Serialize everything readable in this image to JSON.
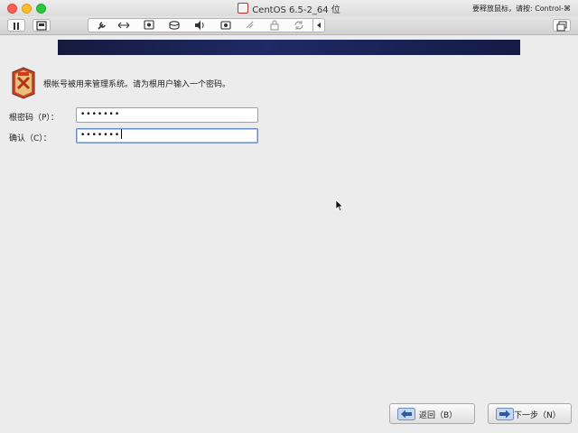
{
  "window": {
    "title": "CentOS 6.5-2_64 位",
    "release_hint": "要释放鼠标，请按: Control-⌘"
  },
  "toolbar": {
    "icons": [
      "pause-icon",
      "vm-settings-icon",
      "wrench-icon",
      "network-arrows-icon",
      "display-icon",
      "disk-icon",
      "audio-icon",
      "camera-icon",
      "usb-icon",
      "lock-icon",
      "refresh-icon",
      "collapse-icon",
      "window-icon"
    ]
  },
  "installer": {
    "banner_color": "#1a2256",
    "prompt": "根帐号被用来管理系统。请为根用户输入一个密码。",
    "password": {
      "label": "根密码（P）：",
      "value": "•••••••"
    },
    "confirm": {
      "label": "确认（C）：",
      "value": "•••••••"
    },
    "back_button": "返回（B）",
    "next_button": "下一步（N）"
  }
}
